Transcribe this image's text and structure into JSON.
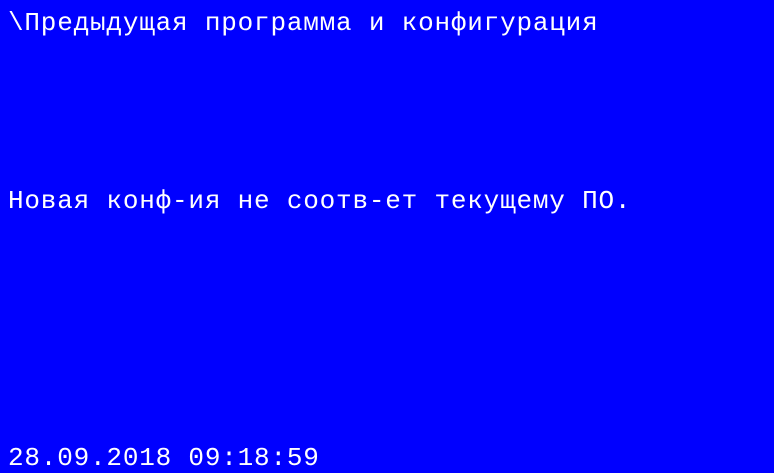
{
  "screen": {
    "title": "\\Предыдущая программа и конфигурация",
    "message": "Новая конф-ия не соотв-ет текущему ПО.",
    "datetime": "28.09.2018 09:18:59",
    "background_color": "#0000ff",
    "text_color": "#ffffff"
  }
}
